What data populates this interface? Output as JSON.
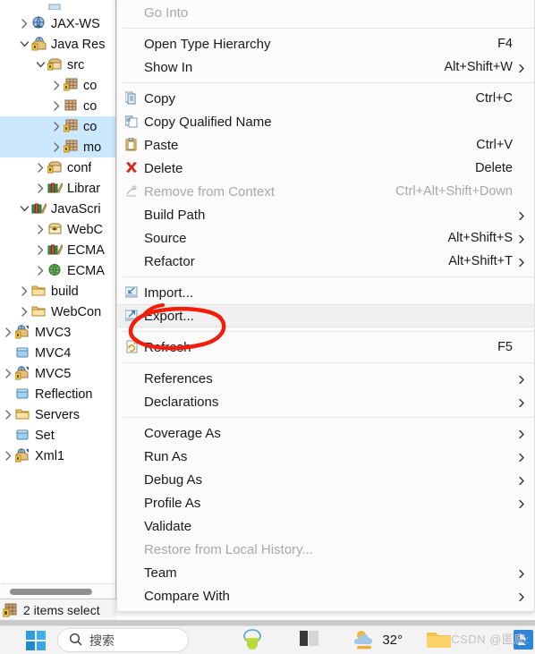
{
  "explorer": {
    "name": "package-explorer",
    "rows": [
      {
        "label": "",
        "indent": 2,
        "twist": "none",
        "icon": "partial-row",
        "selected": false,
        "partial": true
      },
      {
        "label": "JAX-WS",
        "indent": 1,
        "twist": "collapsed",
        "icon": "jaxws-icon",
        "selected": false
      },
      {
        "label": "Java Res",
        "indent": 1,
        "twist": "expanded",
        "icon": "java-resources-icon",
        "selected": false
      },
      {
        "label": "src",
        "indent": 2,
        "twist": "expanded",
        "icon": "source-folder-icon",
        "selected": false
      },
      {
        "label": "co",
        "indent": 3,
        "twist": "collapsed",
        "icon": "package-lock-icon",
        "selected": false
      },
      {
        "label": "co",
        "indent": 3,
        "twist": "collapsed",
        "icon": "package-icon",
        "selected": false
      },
      {
        "label": "co",
        "indent": 3,
        "twist": "collapsed",
        "icon": "package-lock-icon",
        "selected": true
      },
      {
        "label": "mo",
        "indent": 3,
        "twist": "collapsed",
        "icon": "package-lock-icon",
        "selected": true
      },
      {
        "label": "conf",
        "indent": 2,
        "twist": "collapsed",
        "icon": "source-folder-icon",
        "selected": false
      },
      {
        "label": "Librar",
        "indent": 2,
        "twist": "collapsed",
        "icon": "library-icon",
        "selected": false
      },
      {
        "label": "JavaScri",
        "indent": 1,
        "twist": "expanded",
        "icon": "library-icon",
        "selected": false
      },
      {
        "label": "WebC",
        "indent": 2,
        "twist": "collapsed",
        "icon": "js-resources-icon",
        "selected": false
      },
      {
        "label": "ECMA",
        "indent": 2,
        "twist": "collapsed",
        "icon": "library-icon",
        "selected": false
      },
      {
        "label": "ECMA",
        "indent": 2,
        "twist": "collapsed",
        "icon": "globe-icon",
        "selected": false
      },
      {
        "label": "build",
        "indent": 1,
        "twist": "collapsed",
        "icon": "folder-icon",
        "selected": false
      },
      {
        "label": "WebCon",
        "indent": 1,
        "twist": "collapsed",
        "icon": "folder-icon",
        "selected": false
      },
      {
        "label": "MVC3",
        "indent": 0,
        "twist": "collapsed",
        "icon": "web-project-icon",
        "selected": false
      },
      {
        "label": "MVC4",
        "indent": 0,
        "twist": "none",
        "icon": "closed-project-icon",
        "selected": false
      },
      {
        "label": "MVC5",
        "indent": 0,
        "twist": "collapsed",
        "icon": "web-project-icon",
        "selected": false
      },
      {
        "label": "Reflection",
        "indent": 0,
        "twist": "none",
        "icon": "closed-project-icon",
        "selected": false
      },
      {
        "label": "Servers",
        "indent": 0,
        "twist": "collapsed",
        "icon": "folder-icon",
        "selected": false
      },
      {
        "label": "Set",
        "indent": 0,
        "twist": "none",
        "icon": "closed-project-icon",
        "selected": false
      },
      {
        "label": "Xml1",
        "indent": 0,
        "twist": "collapsed",
        "icon": "web-project-icon",
        "selected": false
      }
    ]
  },
  "statusbar": {
    "icon": "package-lock-icon",
    "text": "2 items select"
  },
  "context_menu": {
    "name": "eclipse-context-menu",
    "items": [
      {
        "type": "item",
        "label": "Go Into",
        "accel": "",
        "icon": "",
        "arrow": false,
        "disabled": true,
        "highlighted": false
      },
      {
        "type": "separator"
      },
      {
        "type": "item",
        "label": "Open Type Hierarchy",
        "accel": "F4",
        "icon": "",
        "arrow": false,
        "disabled": false,
        "highlighted": false
      },
      {
        "type": "item",
        "label": "Show In",
        "accel": "Alt+Shift+W",
        "icon": "",
        "arrow": true,
        "disabled": false,
        "highlighted": false
      },
      {
        "type": "separator"
      },
      {
        "type": "item",
        "label": "Copy",
        "accel": "Ctrl+C",
        "icon": "copy-icon",
        "arrow": false,
        "disabled": false,
        "highlighted": false
      },
      {
        "type": "item",
        "label": "Copy Qualified Name",
        "accel": "",
        "icon": "copy-qualified-name-icon",
        "arrow": false,
        "disabled": false,
        "highlighted": false
      },
      {
        "type": "item",
        "label": "Paste",
        "accel": "Ctrl+V",
        "icon": "paste-icon",
        "arrow": false,
        "disabled": false,
        "highlighted": false
      },
      {
        "type": "item",
        "label": "Delete",
        "accel": "Delete",
        "icon": "delete-icon",
        "arrow": false,
        "disabled": false,
        "highlighted": false
      },
      {
        "type": "item",
        "label": "Remove from Context",
        "accel": "Ctrl+Alt+Shift+Down",
        "icon": "remove-from-context-icon",
        "arrow": false,
        "disabled": true,
        "highlighted": false
      },
      {
        "type": "item",
        "label": "Build Path",
        "accel": "",
        "icon": "",
        "arrow": true,
        "disabled": false,
        "highlighted": false
      },
      {
        "type": "item",
        "label": "Source",
        "accel": "Alt+Shift+S",
        "icon": "",
        "arrow": true,
        "disabled": false,
        "highlighted": false
      },
      {
        "type": "item",
        "label": "Refactor",
        "accel": "Alt+Shift+T",
        "icon": "",
        "arrow": true,
        "disabled": false,
        "highlighted": false
      },
      {
        "type": "separator"
      },
      {
        "type": "item",
        "label": "Import...",
        "accel": "",
        "icon": "import-icon",
        "arrow": false,
        "disabled": false,
        "highlighted": false
      },
      {
        "type": "item",
        "label": "Export...",
        "accel": "",
        "icon": "export-icon",
        "arrow": false,
        "disabled": false,
        "highlighted": true
      },
      {
        "type": "separator"
      },
      {
        "type": "item",
        "label": "Refresh",
        "accel": "F5",
        "icon": "refresh-icon",
        "arrow": false,
        "disabled": false,
        "highlighted": false
      },
      {
        "type": "separator"
      },
      {
        "type": "item",
        "label": "References",
        "accel": "",
        "icon": "",
        "arrow": true,
        "disabled": false,
        "highlighted": false
      },
      {
        "type": "item",
        "label": "Declarations",
        "accel": "",
        "icon": "",
        "arrow": true,
        "disabled": false,
        "highlighted": false
      },
      {
        "type": "separator"
      },
      {
        "type": "item",
        "label": "Coverage As",
        "accel": "",
        "icon": "",
        "arrow": true,
        "disabled": false,
        "highlighted": false
      },
      {
        "type": "item",
        "label": "Run As",
        "accel": "",
        "icon": "",
        "arrow": true,
        "disabled": false,
        "highlighted": false
      },
      {
        "type": "item",
        "label": "Debug As",
        "accel": "",
        "icon": "",
        "arrow": true,
        "disabled": false,
        "highlighted": false
      },
      {
        "type": "item",
        "label": "Profile As",
        "accel": "",
        "icon": "",
        "arrow": true,
        "disabled": false,
        "highlighted": false
      },
      {
        "type": "item",
        "label": "Validate",
        "accel": "",
        "icon": "",
        "arrow": false,
        "disabled": false,
        "highlighted": false
      },
      {
        "type": "item",
        "label": "Restore from Local History...",
        "accel": "",
        "icon": "",
        "arrow": false,
        "disabled": true,
        "highlighted": false
      },
      {
        "type": "item",
        "label": "Team",
        "accel": "",
        "icon": "",
        "arrow": true,
        "disabled": false,
        "highlighted": false
      },
      {
        "type": "item",
        "label": "Compare With",
        "accel": "",
        "icon": "",
        "arrow": true,
        "disabled": false,
        "highlighted": false
      }
    ]
  },
  "annotation": {
    "name": "red-circle-annotation",
    "color": "#f01e0a",
    "target": "Export..."
  },
  "taskbar": {
    "start_label": "start-button",
    "search_placeholder": "搜索",
    "weather_temp": "32°",
    "icons": [
      "start-icon",
      "search-icon",
      "widgets-icon",
      "task-view-icon",
      "weather-icon",
      "file-explorer-icon",
      "app-icon"
    ]
  },
  "watermark": {
    "text": "CSDN @匿廊:"
  },
  "colors": {
    "selection": "#cce8ff",
    "menu_bg": "#fbfbfb",
    "menu_highlight": "#f0f0f0",
    "annotation_red": "#f01e0a",
    "disabled_text": "#a8a8a8"
  }
}
